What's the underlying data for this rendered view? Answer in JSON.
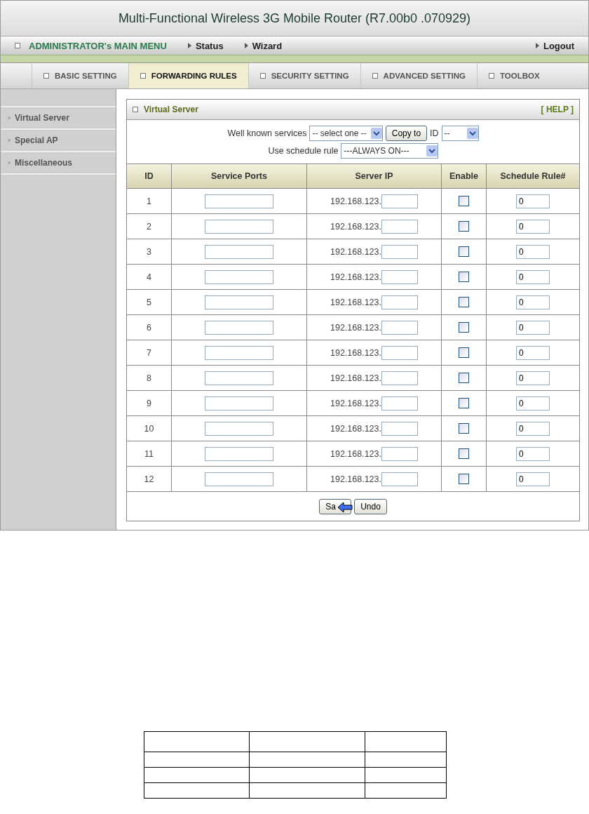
{
  "header": {
    "title": "Multi-Functional Wireless 3G Mobile Router (R7.00b0 .070929)"
  },
  "menu": {
    "main": "ADMINISTRATOR's MAIN MENU",
    "links": [
      "Status",
      "Wizard"
    ],
    "logout": "Logout"
  },
  "tabs": [
    {
      "label": "BASIC SETTING",
      "selected": false
    },
    {
      "label": "FORWARDING RULES",
      "selected": true
    },
    {
      "label": "SECURITY SETTING",
      "selected": false
    },
    {
      "label": "ADVANCED SETTING",
      "selected": false
    },
    {
      "label": "TOOLBOX",
      "selected": false
    }
  ],
  "sidebar": {
    "items": [
      "Virtual Server",
      "Special AP",
      "Miscellaneous"
    ]
  },
  "panel": {
    "title": "Virtual Server",
    "help": "[ HELP ]",
    "services": {
      "label": "Well known services",
      "value": "-- select one --",
      "button": "Copy to",
      "id_label": "ID",
      "id_value": "--"
    },
    "schedule": {
      "label": "Use schedule rule",
      "value": "---ALWAYS ON---"
    },
    "columns": [
      "ID",
      "Service Ports",
      "Server IP",
      "Enable",
      "Schedule Rule#"
    ],
    "rows": [
      {
        "id": "1",
        "ip_prefix": "192.168.123.",
        "enabled": false,
        "rule": "0"
      },
      {
        "id": "2",
        "ip_prefix": "192.168.123.",
        "enabled": false,
        "rule": "0"
      },
      {
        "id": "3",
        "ip_prefix": "192.168.123.",
        "enabled": false,
        "rule": "0"
      },
      {
        "id": "4",
        "ip_prefix": "192.168.123.",
        "enabled": false,
        "rule": "0"
      },
      {
        "id": "5",
        "ip_prefix": "192.168.123.",
        "enabled": false,
        "rule": "0"
      },
      {
        "id": "6",
        "ip_prefix": "192.168.123.",
        "enabled": false,
        "rule": "0"
      },
      {
        "id": "7",
        "ip_prefix": "192.168.123.",
        "enabled": false,
        "rule": "0"
      },
      {
        "id": "8",
        "ip_prefix": "192.168.123.",
        "enabled": false,
        "rule": "0"
      },
      {
        "id": "9",
        "ip_prefix": "192.168.123.",
        "enabled": false,
        "rule": "0"
      },
      {
        "id": "10",
        "ip_prefix": "192.168.123.",
        "enabled": false,
        "rule": "0"
      },
      {
        "id": "11",
        "ip_prefix": "192.168.123.",
        "enabled": false,
        "rule": "0"
      },
      {
        "id": "12",
        "ip_prefix": "192.168.123.",
        "enabled": false,
        "rule": "0"
      }
    ],
    "buttons": [
      "Sa",
      "Undo"
    ]
  }
}
